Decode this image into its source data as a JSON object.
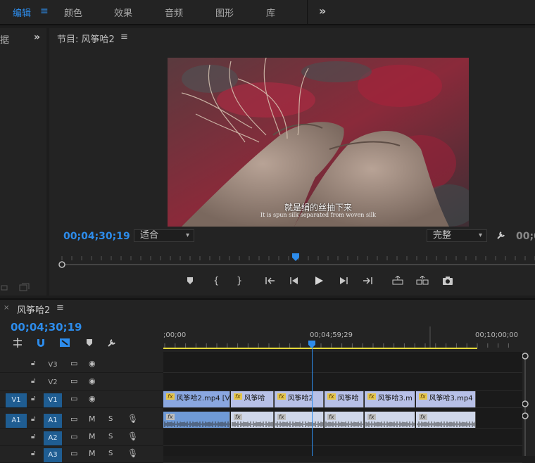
{
  "workspaces": {
    "items": [
      "编辑",
      "颜色",
      "效果",
      "音频",
      "图形",
      "库"
    ],
    "active": "编辑",
    "menu_glyph": "≡",
    "more_glyph": "»"
  },
  "left_panel": {
    "tab_fragment": "据",
    "more_glyph": "»"
  },
  "program_monitor": {
    "title": "节目: 风筝哈2",
    "menu_glyph": "≡",
    "subtitle_cn": "就是绢的丝抽下来",
    "subtitle_en": "It is spun silk separated from woven silk",
    "timecode": "00;04;30;19",
    "fit_select": "适合",
    "quality_select": "完整",
    "duration_timecode": "00;0",
    "playhead_fraction": 0.5
  },
  "timeline": {
    "sequence_name": "风筝哈2",
    "menu_glyph": "≡",
    "close_glyph": "×",
    "timecode": "00;04;30;19",
    "ruler_labels": [
      ";00;00",
      "00;04;59;29",
      "00;10;00;00"
    ],
    "tracks": [
      {
        "id": "V3",
        "source": "",
        "type": "video"
      },
      {
        "id": "V2",
        "source": "",
        "type": "video"
      },
      {
        "id": "V1",
        "source": "V1",
        "type": "video"
      },
      {
        "id": "A1",
        "source": "A1",
        "type": "audio"
      },
      {
        "id": "A2",
        "source": "",
        "type": "audio"
      },
      {
        "id": "A3",
        "source": "",
        "type": "audio"
      }
    ],
    "audio_buttons": {
      "mute": "M",
      "solo": "S"
    },
    "video_clips": [
      {
        "label": "风筝哈2.mp4 [V]",
        "fx": "fx",
        "selected": true
      },
      {
        "label": "风筝哈",
        "fx": "fx",
        "selected": false
      },
      {
        "label": "风筝哈2",
        "fx": "fx",
        "selected": false
      },
      {
        "label": "风筝哈",
        "fx": "fx",
        "selected": false
      },
      {
        "label": "风筝哈3.m",
        "fx": "fx",
        "selected": false
      },
      {
        "label": "风筝哈3.mp4",
        "fx": "fx",
        "selected": false
      }
    ],
    "audio_fx": "fx"
  },
  "colors": {
    "accent": "#2d8ceb",
    "track_target": "#1f5d92",
    "work_area": "#e5d93a",
    "video_clip": "#b7c0e7",
    "audio_clip": "#cfd7ea",
    "fx_badge": "#e4c54c"
  },
  "icons": {
    "lock": "lock-icon",
    "toggle_output": "film-icon",
    "eye": "eye-icon",
    "mic": "microphone-icon",
    "wrench": "wrench-icon"
  }
}
